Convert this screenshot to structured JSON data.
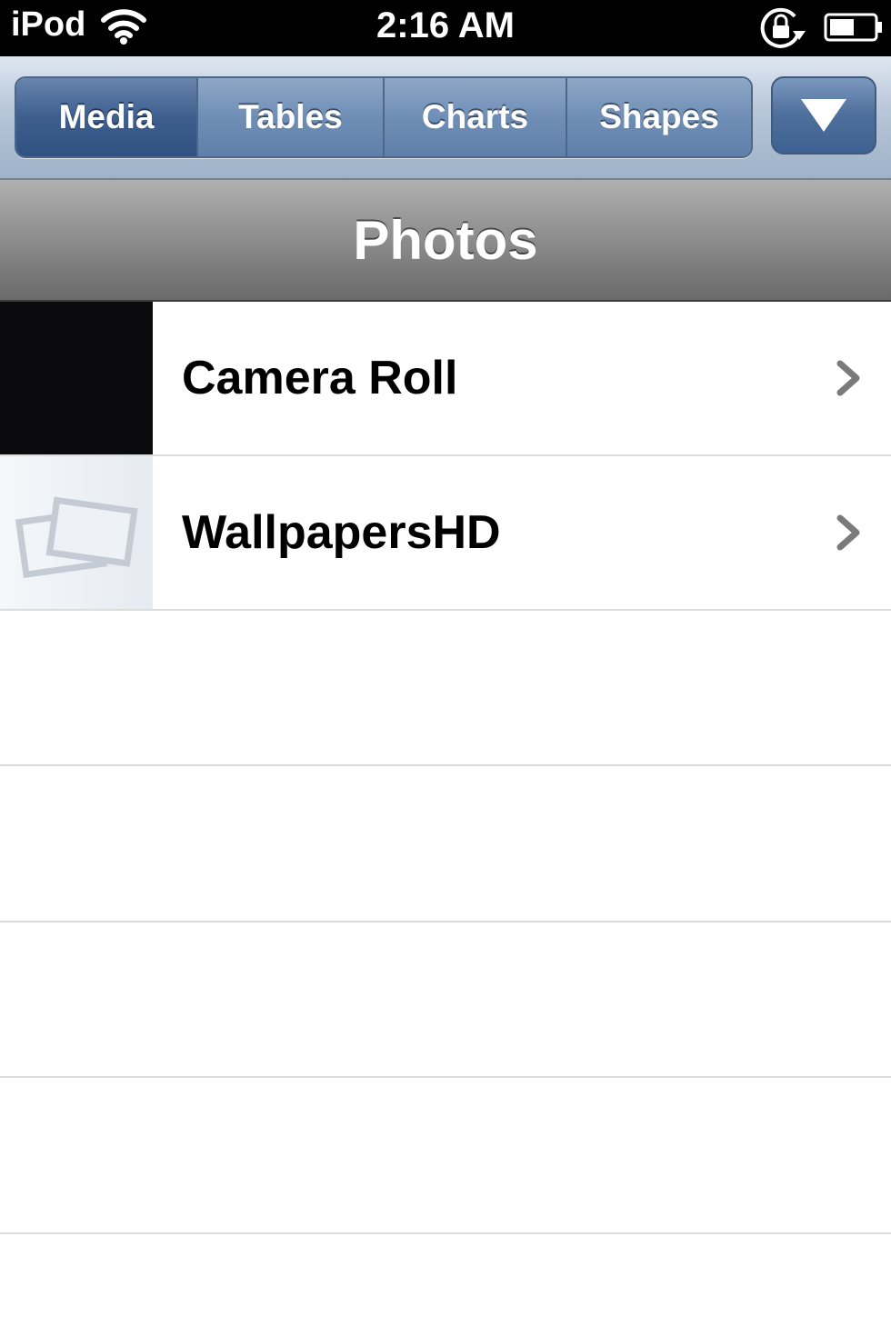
{
  "status_bar": {
    "carrier": "iPod",
    "time": "2:16 AM"
  },
  "toolbar": {
    "tabs": [
      {
        "label": "Media",
        "active": true
      },
      {
        "label": "Tables",
        "active": false
      },
      {
        "label": "Charts",
        "active": false
      },
      {
        "label": "Shapes",
        "active": false
      }
    ]
  },
  "header": {
    "title": "Photos"
  },
  "albums": [
    {
      "name": "Camera Roll",
      "thumbnail": "dark-photo"
    },
    {
      "name": "WallpapersHD",
      "thumbnail": "placeholder-photos-icon"
    }
  ],
  "colors": {
    "toolbar_active": "#3e5f8e",
    "toolbar_tint": "#6f8eb6",
    "header_gray": "#8c8c8c"
  }
}
